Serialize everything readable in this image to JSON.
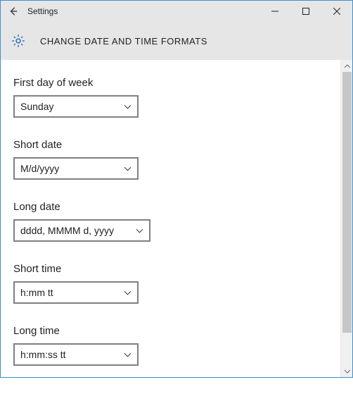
{
  "window": {
    "title": "Settings"
  },
  "header": {
    "page_title": "CHANGE DATE AND TIME FORMATS"
  },
  "fields": {
    "first_day_of_week": {
      "label": "First day of week",
      "value": "Sunday"
    },
    "short_date": {
      "label": "Short date",
      "value": "M/d/yyyy"
    },
    "long_date": {
      "label": "Long date",
      "value": "dddd, MMMM d, yyyy"
    },
    "short_time": {
      "label": "Short time",
      "value": "h:mm tt"
    },
    "long_time": {
      "label": "Long time",
      "value": "h:mm:ss tt"
    }
  }
}
